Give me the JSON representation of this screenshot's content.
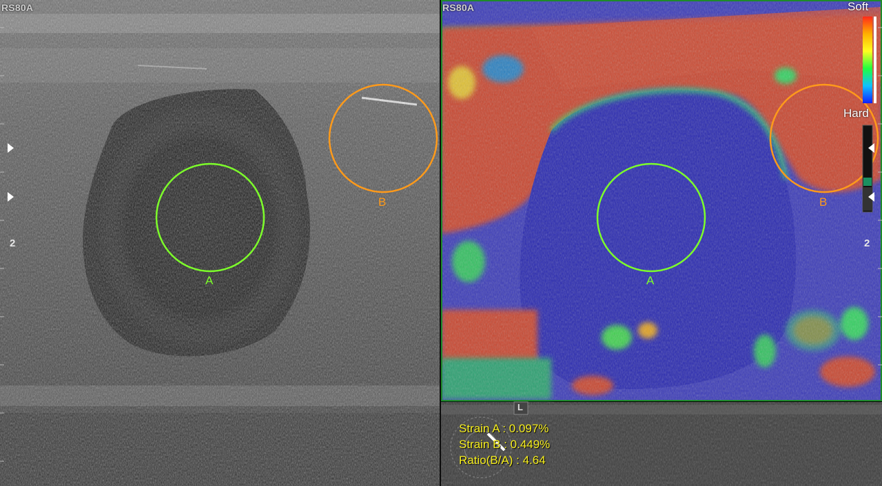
{
  "left_panel": {
    "probe_label": "RS80A",
    "roi_a_label": "A",
    "roi_b_label": "B",
    "depth_label": "2"
  },
  "right_panel": {
    "probe_label": "RS80A",
    "roi_a_label": "A",
    "roi_b_label": "B",
    "depth_label": "2",
    "colorbar": {
      "top_label": "Soft",
      "bottom_label": "Hard"
    },
    "orientation_label": "L",
    "measurements": {
      "strain_a": "Strain A : 0.097%",
      "strain_b": "Strain B : 0.449%",
      "ratio": "Ratio(B/A) : 4.64"
    }
  },
  "colors": {
    "roi_a": "#7dff2a",
    "roi_b": "#ff9a1a",
    "measure_text": "#f7ef1e"
  }
}
